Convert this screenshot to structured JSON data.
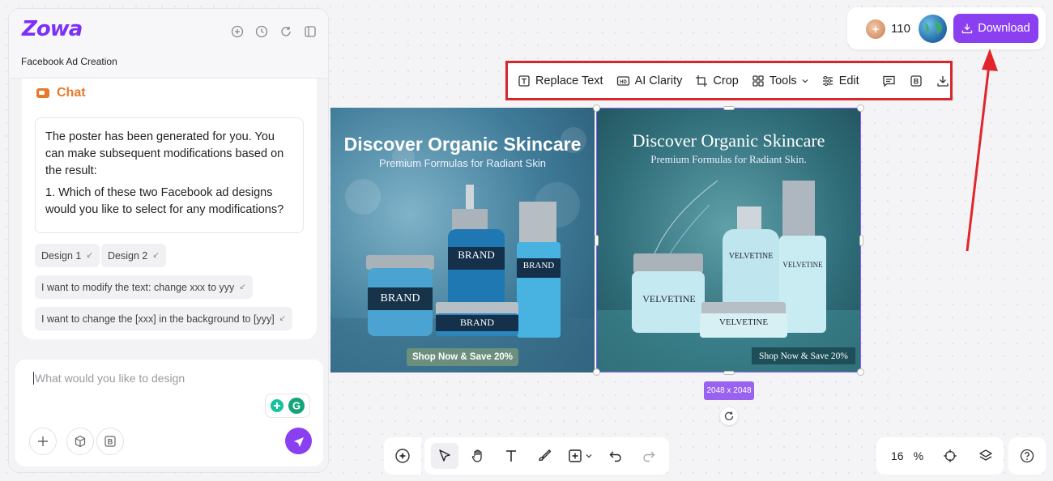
{
  "app": {
    "logo": "Zowa",
    "project_title": "Facebook Ad Creation"
  },
  "panel": {
    "header_icons": [
      "new-icon",
      "history-icon",
      "refresh-icon",
      "collapse-icon"
    ],
    "chat_label": "Chat",
    "message": {
      "line1": "The poster has been generated for you. You can make subsequent modifications based on the result:",
      "line2": "1. Which of these two Facebook ad designs would you like to select for any modifications?"
    },
    "suggestions": [
      "Design 1",
      "Design 2",
      "I want to modify the text: change xxx to yyy",
      "I want to change the [xxx] in the background to [yyy]"
    ],
    "input_placeholder": "What would you like to design"
  },
  "toolbar": {
    "replace_text": "Replace Text",
    "ai_clarity": "AI Clarity",
    "crop": "Crop",
    "tools": "Tools",
    "edit": "Edit"
  },
  "top_right": {
    "credits": "110",
    "download": "Download"
  },
  "posters": [
    {
      "title": "Discover Organic Skincare",
      "subtitle": "Premium Formulas for Radiant Skin",
      "brand": "BRAND",
      "cta": "Shop Now & Save 20%"
    },
    {
      "title": "Discover Organic Skincare",
      "subtitle": "Premium Formulas for Radiant Skin.",
      "brand": "VELVETINE",
      "cta": "Shop Now & Save 20%"
    }
  ],
  "selection": {
    "size_label": "2048 x 2048"
  },
  "zoom": {
    "value": "16",
    "unit": "%"
  },
  "colors": {
    "accent": "#8a3ff0",
    "highlight_border": "#d9262b",
    "chat_orange": "#e8782a"
  }
}
